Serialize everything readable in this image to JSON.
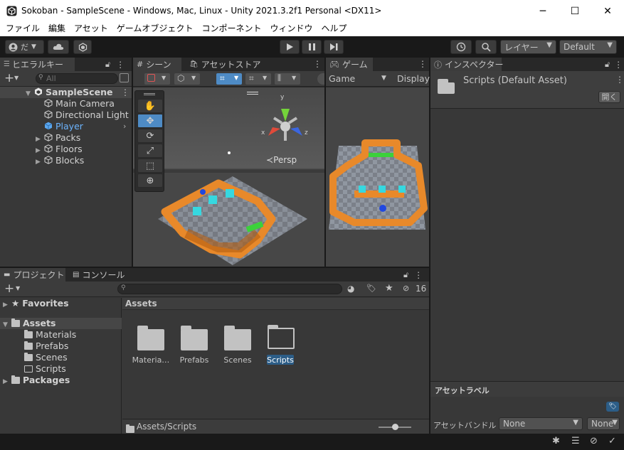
{
  "window": {
    "title": "Sokoban - SampleScene - Windows, Mac, Linux - Unity 2021.3.2f1 Personal <DX11>",
    "minimize": "─",
    "maximize": "☐",
    "close": "✕"
  },
  "menu": [
    "ファイル",
    "編集",
    "アセット",
    "ゲームオブジェクト",
    "コンポーネント",
    "ウィンドウ",
    "ヘルプ"
  ],
  "toolbar": {
    "account_label": "だ",
    "layers_label": "レイヤー",
    "layout_label": "Default"
  },
  "hierarchy": {
    "tab_label": "ヒエラルキー",
    "search_placeholder": "All",
    "scene_name": "SampleScene",
    "items": [
      "Main Camera",
      "Directional Light",
      "Player",
      "Packs",
      "Floors",
      "Blocks"
    ]
  },
  "scene_view": {
    "tab_label": "シーン",
    "asset_store_tab": "アセットストア",
    "persp_label": "Persp",
    "gizmo": {
      "y": "y",
      "x": "x",
      "z": "z"
    }
  },
  "game_view": {
    "tab_label": "ゲーム",
    "display_select": "Game",
    "display_label": "Display"
  },
  "inspector": {
    "tab_label": "インスペクター",
    "asset_title": "Scripts (Default Asset)",
    "open_button": "開く",
    "asset_labels_header": "アセットラベル",
    "asset_bundle_label": "アセットバンドル",
    "bundle_value": "None",
    "bundle_variant": "None"
  },
  "project": {
    "tab_label": "プロジェクト",
    "console_tab": "コンソール",
    "hidden_count": "16",
    "tree": {
      "favorites": "Favorites",
      "assets": "Assets",
      "asset_children": [
        "Materials",
        "Prefabs",
        "Scenes",
        "Scripts"
      ],
      "packages": "Packages"
    },
    "breadcrumb": "Assets",
    "grid_items": [
      "Materia…",
      "Prefabs",
      "Scenes",
      "Scripts"
    ],
    "footer_path": "Assets/Scripts"
  },
  "colors": {
    "accent": "#2c5d87",
    "selection": "#4e8bc5",
    "panel": "#383838",
    "dark": "#191919",
    "block_orange": "#e8892a",
    "goal_green": "#3bd13b",
    "box_cyan": "#36d8e0"
  }
}
